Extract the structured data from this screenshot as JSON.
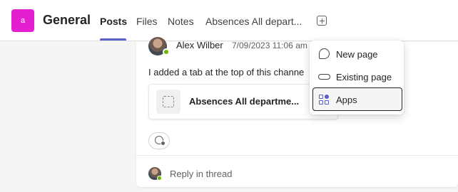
{
  "header": {
    "team_avatar_letter": "a",
    "channel_name": "General",
    "tabs": [
      {
        "label": "Posts",
        "active": true
      },
      {
        "label": "Files",
        "active": false
      },
      {
        "label": "Notes",
        "active": false
      },
      {
        "label": "Absences All depart...",
        "active": false
      }
    ],
    "add_tab_icon": "add-square-icon"
  },
  "post": {
    "sender": "Alex Wilber",
    "timestamp": "7/09/2023 11:06 am",
    "message": "I added a tab at the top of this channe",
    "attachment_title": "Absences All departme...",
    "reaction_icon": "emoji-add-icon",
    "reply_label": "Reply in thread"
  },
  "menu": {
    "items": [
      {
        "label": "New page",
        "icon": "chat-bubble-icon"
      },
      {
        "label": "Existing page",
        "icon": "link-icon"
      },
      {
        "label": "Apps",
        "icon": "apps-icon",
        "selected": true
      }
    ]
  },
  "colors": {
    "team_avatar": "#e31fd0",
    "accent": "#5b5fc7",
    "presence": "#6bb700"
  }
}
